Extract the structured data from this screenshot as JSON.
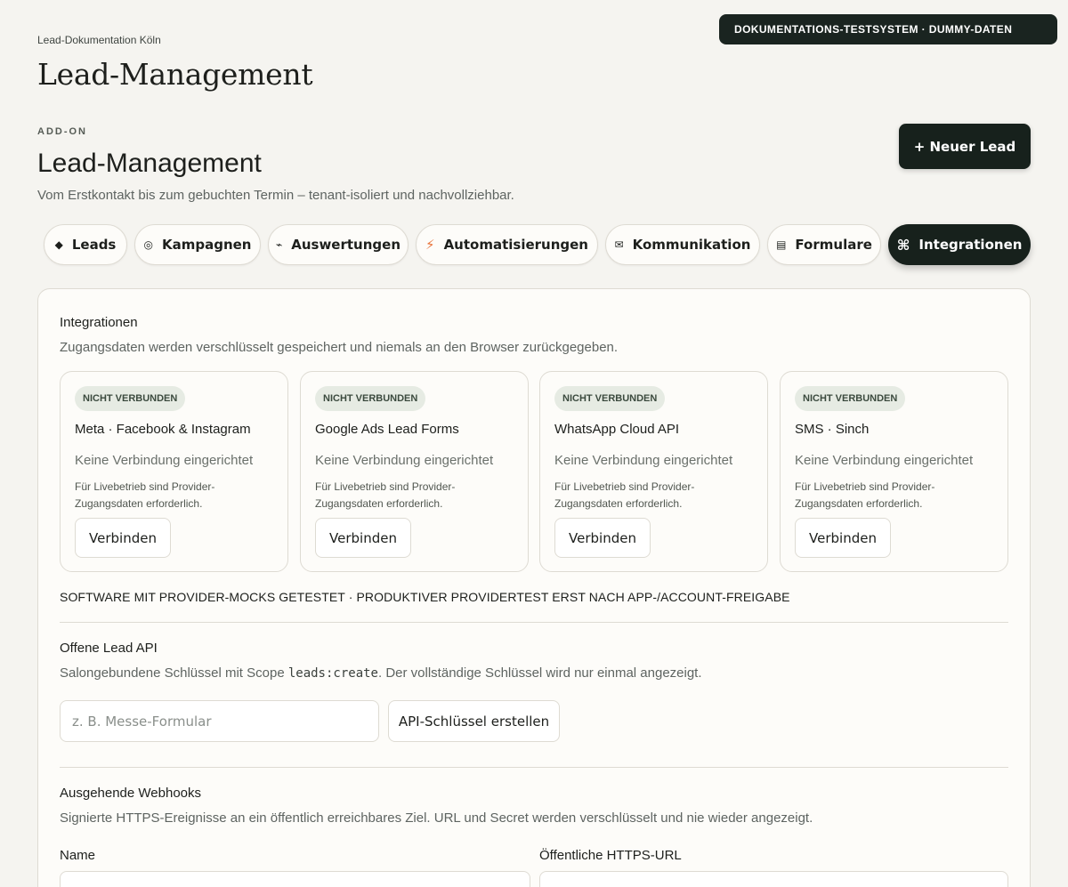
{
  "system_badge": "DOKUMENTATIONS-TESTSYSTEM · DUMMY-DATEN",
  "breadcrumb": "Lead-Dokumentation Köln",
  "page_title": "Lead-Management",
  "header": {
    "kicker": "ADD-ON",
    "title": "Lead-Management",
    "subtitle": "Vom Erstkontakt bis zum gebuchten Termin – tenant-isoliert und nachvollziehbar.",
    "new_lead_label": "+ Neuer Lead"
  },
  "tabs": [
    {
      "label": "Leads",
      "icon": "diamond-icon",
      "glyph": "◆",
      "active": false
    },
    {
      "label": "Kampagnen",
      "icon": "target-icon",
      "glyph": "◎",
      "active": false
    },
    {
      "label": "Auswertungen",
      "icon": "trend-icon",
      "glyph": "⌁",
      "active": false
    },
    {
      "label": "Automatisierungen",
      "icon": "bolt-icon",
      "glyph": "⚡",
      "active": false
    },
    {
      "label": "Kommunikation",
      "icon": "mail-icon",
      "glyph": "✉",
      "active": false
    },
    {
      "label": "Formulare",
      "icon": "form-icon",
      "glyph": "▤",
      "active": false
    },
    {
      "label": "Integrationen",
      "icon": "command-icon",
      "glyph": "⌘",
      "active": true
    }
  ],
  "integrations": {
    "heading": "Integrationen",
    "description": "Zugangsdaten werden verschlüsselt gespeichert und niemals an den Browser zurückgegeben.",
    "items": [
      {
        "status": "NICHT VERBUNDEN",
        "name": "Meta · Facebook & Instagram",
        "state": "Keine Verbindung eingerichtet",
        "note": "Für Livebetrieb sind Provider-Zugangsdaten erforderlich.",
        "button": "Verbinden"
      },
      {
        "status": "NICHT VERBUNDEN",
        "name": "Google Ads Lead Forms",
        "state": "Keine Verbindung eingerichtet",
        "note": "Für Livebetrieb sind Provider-Zugangsdaten erforderlich.",
        "button": "Verbinden"
      },
      {
        "status": "NICHT VERBUNDEN",
        "name": "WhatsApp Cloud API",
        "state": "Keine Verbindung eingerichtet",
        "note": "Für Livebetrieb sind Provider-Zugangsdaten erforderlich.",
        "button": "Verbinden"
      },
      {
        "status": "NICHT VERBUNDEN",
        "name": "SMS · Sinch",
        "state": "Keine Verbindung eingerichtet",
        "note": "Für Livebetrieb sind Provider-Zugangsdaten erforderlich.",
        "button": "Verbinden"
      }
    ],
    "mock_note": "SOFTWARE MIT PROVIDER-MOCKS GETESTET · PRODUKTIVER PROVIDERTEST ERST NACH APP-/ACCOUNT-FREIGABE"
  },
  "lead_api": {
    "heading": "Offene Lead API",
    "desc_before": "Salongebundene Schlüssel mit Scope ",
    "desc_code": "leads:create",
    "desc_after": ". Der vollständige Schlüssel wird nur einmal angezeigt.",
    "input_placeholder": "z. B. Messe-Formular",
    "input_value": "",
    "create_button": "API-Schlüssel erstellen"
  },
  "webhooks": {
    "heading": "Ausgehende Webhooks",
    "description": "Signierte HTTPS-Ereignisse an ein öffentlich erreichbares Ziel. URL und Secret werden verschlüsselt und nie wieder angezeigt.",
    "name_label": "Name",
    "url_label": "Öffentliche HTTPS-URL"
  }
}
